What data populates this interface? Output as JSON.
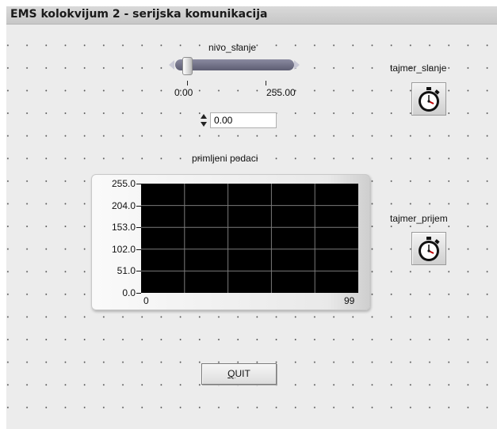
{
  "window": {
    "title": "EMS kolokvijum 2 - serijska komunikacija"
  },
  "slider": {
    "label": "nivo_slanje",
    "min_label": "0.00",
    "max_label": "255.00",
    "value": 0
  },
  "numeric": {
    "value": "0.00"
  },
  "timers": [
    {
      "label": "tajmer_slanje",
      "icon": "stopwatch-icon"
    },
    {
      "label": "tajmer_prijem",
      "icon": "stopwatch-icon"
    }
  ],
  "chart_data": {
    "type": "line",
    "title": "primljeni podaci",
    "x_ticks": [
      "0",
      "99"
    ],
    "y_ticks": [
      "255.0",
      "204.0",
      "153.0",
      "102.0",
      "51.0",
      "0.0"
    ],
    "xlim": [
      0,
      99
    ],
    "ylim": [
      0,
      255
    ],
    "grid": true,
    "series": []
  },
  "buttons": {
    "quit_prefix": "Q",
    "quit_rest": "UIT"
  },
  "colors": {
    "plot_bg": "#000000",
    "grid": "#7a7a7a",
    "panel": "#ececec",
    "slider": "#6b6b80"
  }
}
